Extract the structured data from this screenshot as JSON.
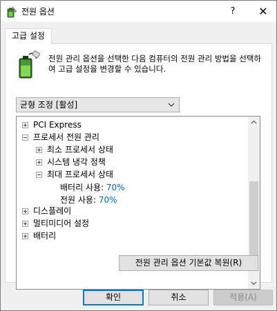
{
  "window": {
    "title": "전원 옵션",
    "help_glyph": "?",
    "close_glyph": "✕"
  },
  "tabs": [
    {
      "label": "고급 설정"
    }
  ],
  "description": "전원 관리 옵션을 선택한 다음 컴퓨터의 전원 관리 방법을 선택하여 고급 설정을 변경할 수 있습니다.",
  "plan_select": {
    "value": "균형 조정 [활성]"
  },
  "tree": {
    "items": [
      {
        "label": "PCI Express",
        "expander": "plus"
      },
      {
        "label": "프로세서 전원 관리",
        "expander": "minus"
      },
      {
        "label": "최소 프로세서 상태",
        "expander": "plus"
      },
      {
        "label": "시스템 냉각 정책",
        "expander": "plus"
      },
      {
        "label": "최대 프로세서 상태",
        "expander": "minus"
      },
      {
        "label": "배터리 사용:",
        "value": "70%"
      },
      {
        "label": "전원 사용:",
        "value": "70%"
      },
      {
        "label": "디스플레이",
        "expander": "plus"
      },
      {
        "label": "멀티미디어 설정",
        "expander": "plus"
      },
      {
        "label": "배터리",
        "expander": "plus"
      }
    ]
  },
  "buttons": {
    "restore": "전원 관리 옵션 기본값 복원(R)",
    "ok": "확인",
    "cancel": "취소",
    "apply": "적용(A)"
  },
  "colors": {
    "value_link": "#0066cc",
    "focus_border": "#0078d7"
  }
}
